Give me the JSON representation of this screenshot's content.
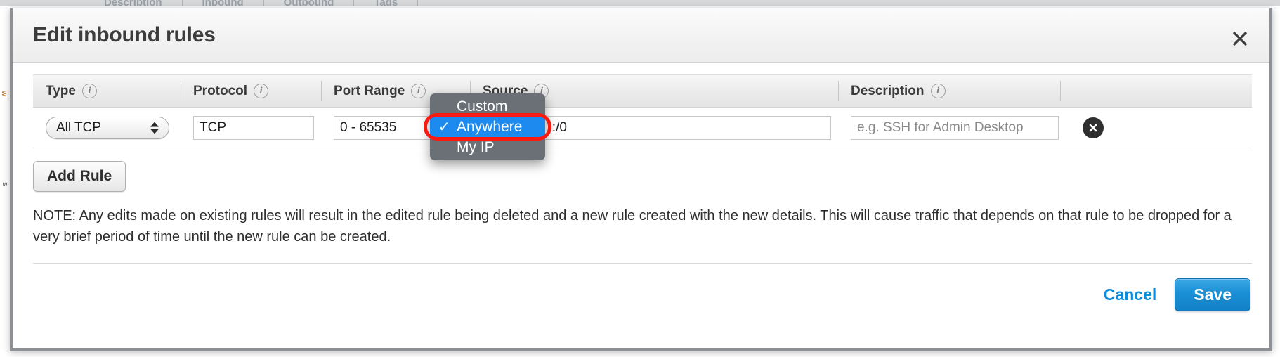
{
  "background": {
    "tabs": [
      "Description",
      "Inbound",
      "Outbound",
      "Tags"
    ],
    "left_label_1": "w",
    "left_label_2": "s"
  },
  "modal": {
    "title": "Edit inbound rules",
    "close_icon": "close-icon"
  },
  "table": {
    "columns": [
      {
        "label": "Type",
        "info_icon": "info-icon"
      },
      {
        "label": "Protocol",
        "info_icon": "info-icon"
      },
      {
        "label": "Port Range",
        "info_icon": "info-icon"
      },
      {
        "label": "Source",
        "info_icon": "info-icon"
      },
      {
        "label": "Description",
        "info_icon": "info-icon"
      }
    ],
    "rows": [
      {
        "type_value": "All TCP",
        "protocol_value": "TCP",
        "port_value": "0 - 65535",
        "source_value": "0.0.0.0/0, ::/0",
        "description_value": "",
        "description_placeholder": "e.g. SSH for Admin Desktop",
        "delete_icon": "delete-circle-x-icon"
      }
    ]
  },
  "source_dropdown": {
    "open": true,
    "options": [
      "Custom",
      "Anywhere",
      "My IP"
    ],
    "selected": "Anywhere",
    "selected_index": 1,
    "check_glyph": "✓",
    "menu_bg_color": "#6b7077",
    "selected_bg_color": "#1d8aef",
    "highlight_ring_color": "#fb1a10"
  },
  "buttons": {
    "add_rule": "Add Rule",
    "cancel": "Cancel",
    "save": "Save"
  },
  "note": {
    "text": "NOTE: Any edits made on existing rules will result in the edited rule being deleted and a new rule created with the new details. This will cause traffic that depends on that rule to be dropped for a very brief period of time until the new rule can be created."
  },
  "colors": {
    "accent_blue": "#0d8cd9",
    "save_blue": "#1a8fd6",
    "highlight_red": "#fb1a10",
    "menu_gray": "#6b7077"
  }
}
